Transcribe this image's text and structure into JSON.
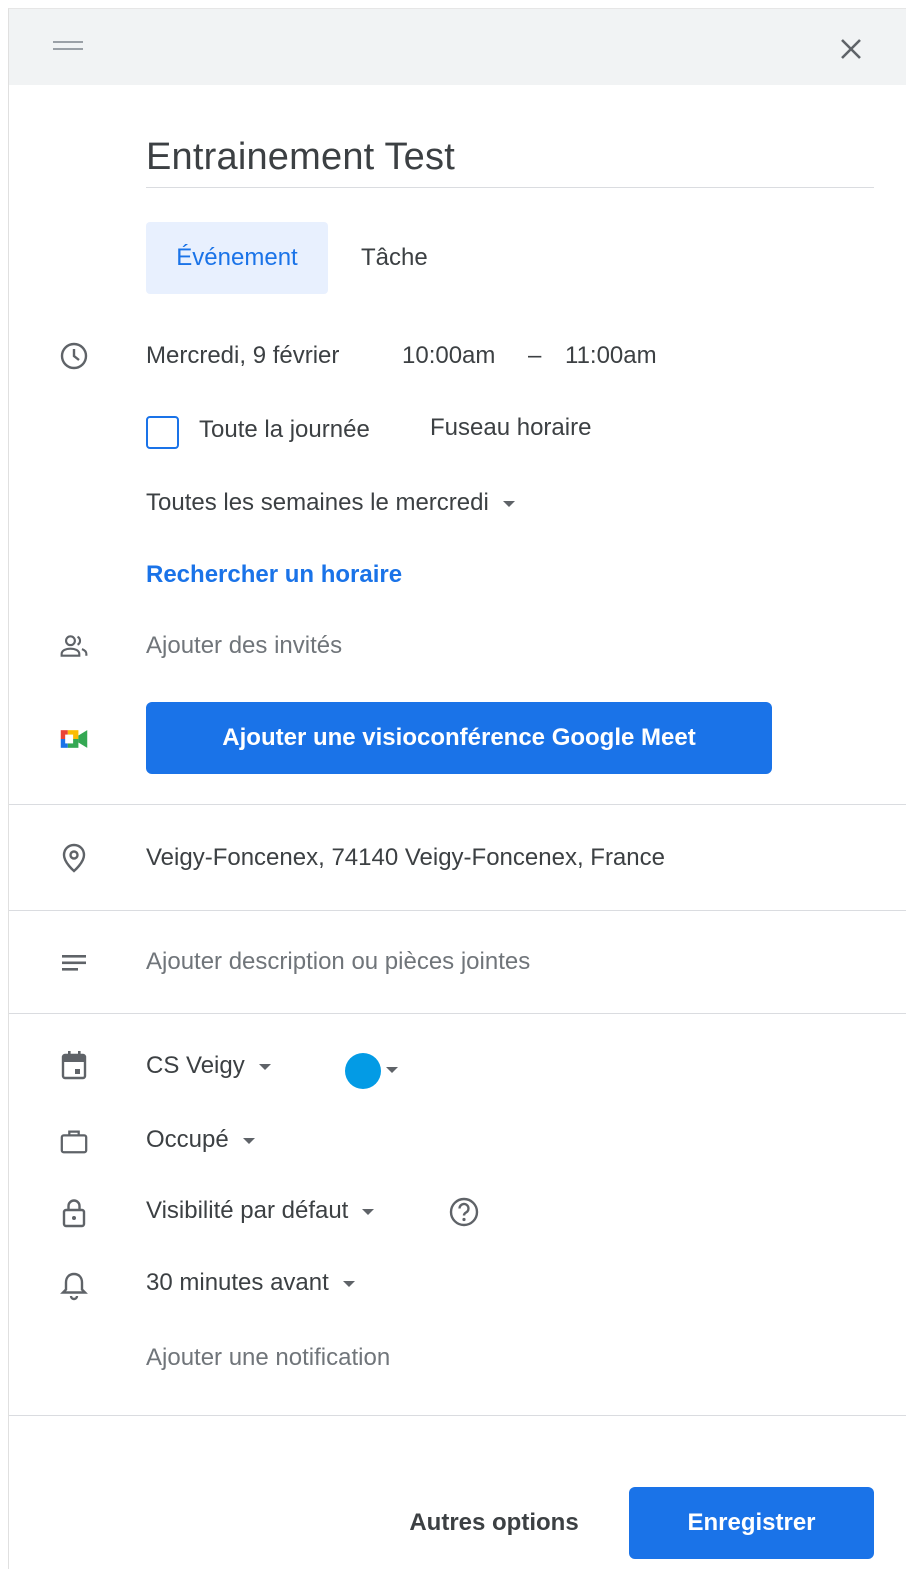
{
  "dialog": {
    "close_icon": "close-icon",
    "drag_icon": "drag-handle-icon"
  },
  "event": {
    "title": "Entrainement Test"
  },
  "tabs": [
    {
      "label": "Événement",
      "selected": true
    },
    {
      "label": "Tâche",
      "selected": false
    }
  ],
  "datetime": {
    "date": "Mercredi, 9 février",
    "start": "10:00am",
    "separator": "–",
    "end": "11:00am",
    "all_day_label": "Toute la journée",
    "all_day_checked": false,
    "timezone_label": "Fuseau horaire",
    "recurrence": "Toutes les semaines le mercredi",
    "find_time": "Rechercher un horaire"
  },
  "guests": {
    "placeholder": "Ajouter des invités"
  },
  "meet": {
    "button_label": "Ajouter une visioconférence Google Meet"
  },
  "location": {
    "value": "Veigy-Foncenex, 74140 Veigy-Foncenex, France"
  },
  "description": {
    "placeholder": "Ajouter description ou pièces jointes"
  },
  "calendar": {
    "name": "CS Veigy",
    "color": "#039be5"
  },
  "availability": {
    "value": "Occupé"
  },
  "visibility": {
    "value": "Visibilité par défaut"
  },
  "notification": {
    "value": "30 minutes avant",
    "add_label": "Ajouter une notification"
  },
  "footer": {
    "more_options": "Autres options",
    "save": "Enregistrer"
  },
  "colors": {
    "accent": "#1a73e8",
    "tab_selected_bg": "#e8f0fe",
    "topbar_bg": "#f1f3f4"
  }
}
